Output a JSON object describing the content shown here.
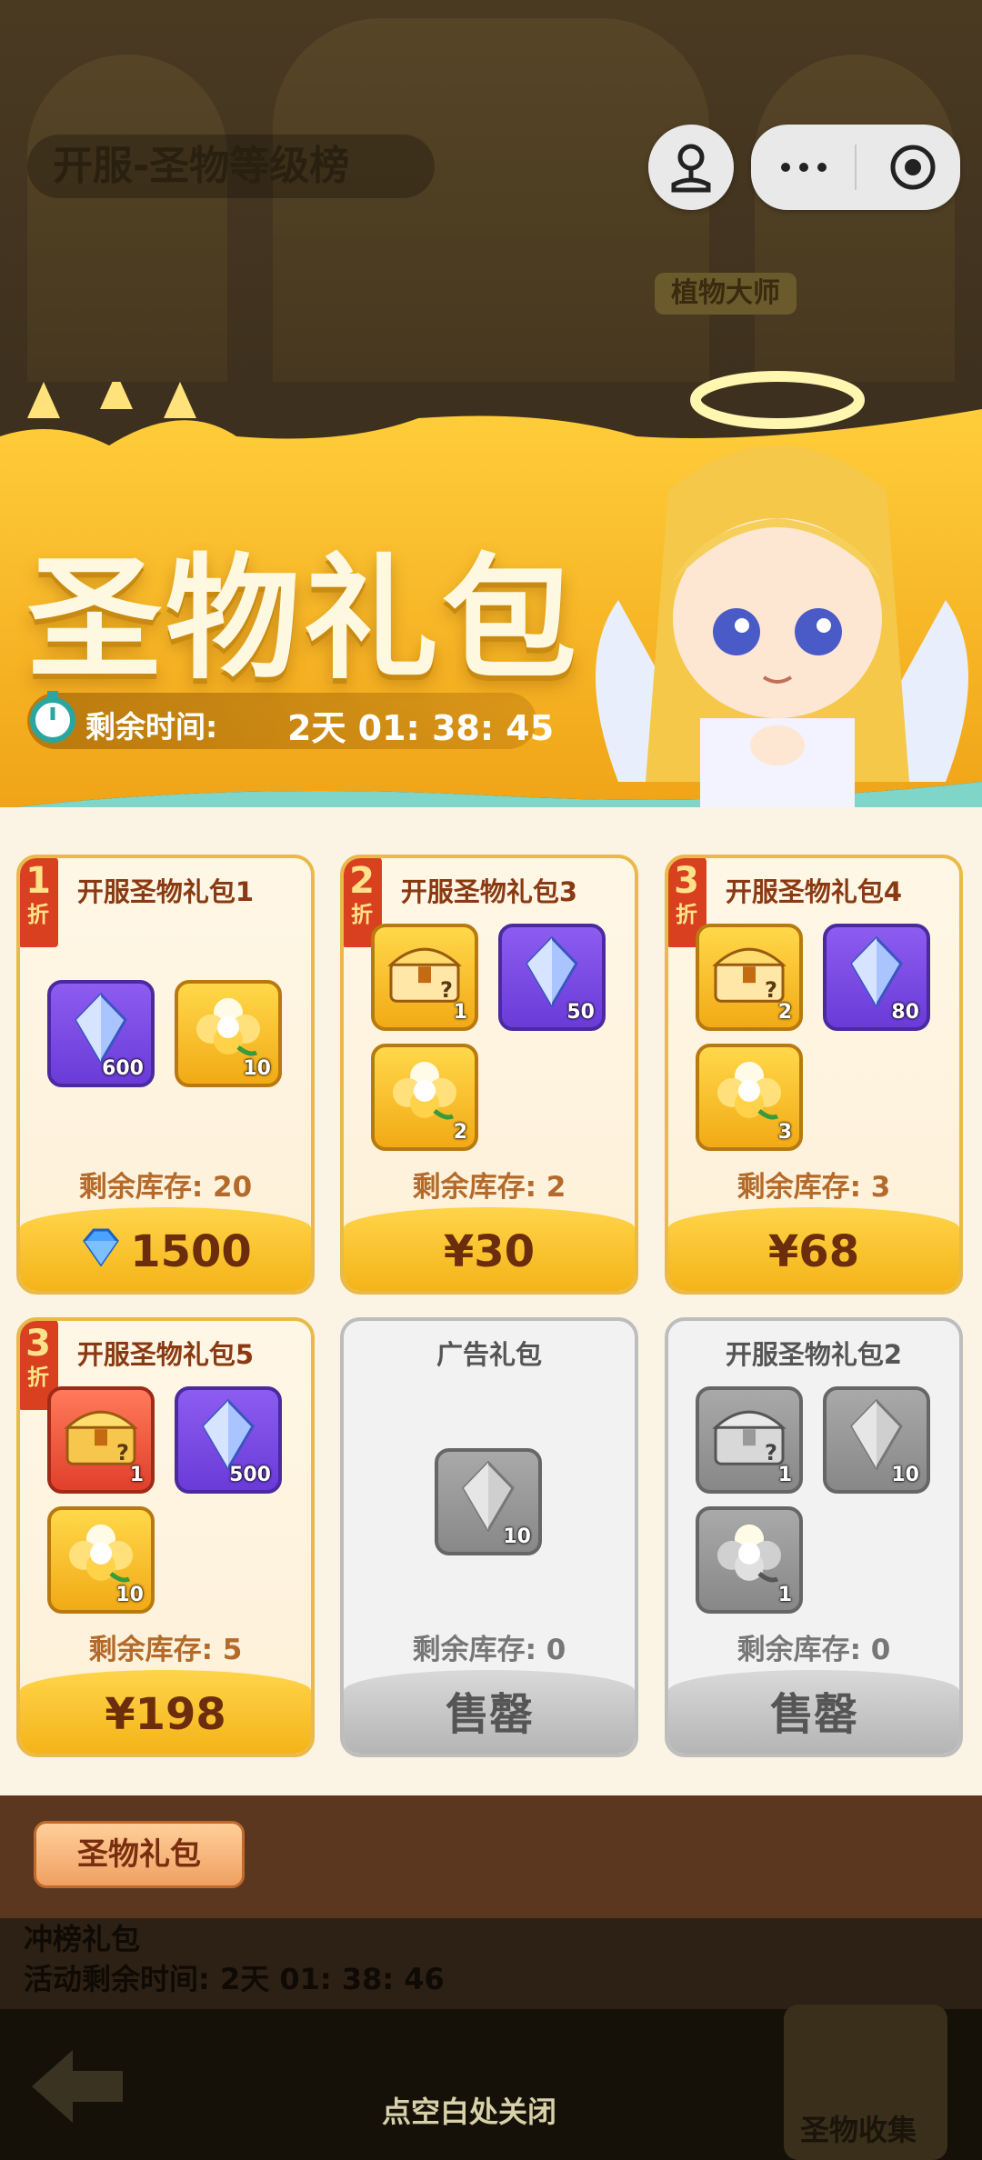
{
  "background": {
    "title": "开服-圣物等级榜",
    "badge": "植物大师",
    "rank_title": "冲榜礼包",
    "rank_timer": "活动剩余时间: 2天 01: 38: 46",
    "collect_label": "圣物收集",
    "close_hint": "点空白处关闭"
  },
  "banner": {
    "title": "圣物礼包",
    "timer_label": "剩余时间:",
    "timer_value": "2天 01: 38: 45"
  },
  "cards": [
    {
      "title": "开服圣物礼包1",
      "discount": "1",
      "discount_unit": "折",
      "style": "gold",
      "stock": "剩余库存: 20",
      "price": "1500",
      "price_icon": "diamond-icon",
      "items": [
        {
          "icon": "crystal-icon",
          "color": "purple",
          "qty": "600"
        },
        {
          "icon": "flower-icon",
          "color": "gold",
          "qty": "10"
        }
      ]
    },
    {
      "title": "开服圣物礼包3",
      "discount": "2",
      "discount_unit": "折",
      "style": "gold",
      "stock": "剩余库存: 2",
      "price": "¥30",
      "items": [
        {
          "icon": "chest-icon",
          "color": "gold",
          "qty": "1"
        },
        {
          "icon": "crystal-icon",
          "color": "purple",
          "qty": "50"
        },
        {
          "icon": "flower-icon",
          "color": "gold",
          "qty": "2"
        }
      ]
    },
    {
      "title": "开服圣物礼包4",
      "discount": "3",
      "discount_unit": "折",
      "style": "gold",
      "stock": "剩余库存: 3",
      "price": "¥68",
      "items": [
        {
          "icon": "chest-icon",
          "color": "gold",
          "qty": "2"
        },
        {
          "icon": "crystal-icon",
          "color": "purple",
          "qty": "80"
        },
        {
          "icon": "flower-icon",
          "color": "gold",
          "qty": "3"
        }
      ]
    },
    {
      "title": "开服圣物礼包5",
      "discount": "3",
      "discount_unit": "折",
      "style": "gold",
      "stock": "剩余库存: 5",
      "price": "¥198",
      "items": [
        {
          "icon": "chest-icon",
          "color": "red",
          "qty": "1"
        },
        {
          "icon": "crystal-icon",
          "color": "purple",
          "qty": "500"
        },
        {
          "icon": "flower-icon",
          "color": "gold",
          "qty": "10"
        }
      ]
    },
    {
      "title": "广告礼包",
      "style": "grey",
      "stock": "剩余库存: 0",
      "price": "售罄",
      "items": [
        {
          "icon": "crystal-icon",
          "color": "greyitem",
          "qty": "10"
        }
      ]
    },
    {
      "title": "开服圣物礼包2",
      "style": "grey",
      "stock": "剩余库存: 0",
      "price": "售罄",
      "items": [
        {
          "icon": "chest-icon",
          "color": "greyitem",
          "qty": "1"
        },
        {
          "icon": "crystal-icon",
          "color": "greyitem",
          "qty": "10"
        },
        {
          "icon": "flower-icon",
          "color": "greyitem",
          "qty": "1"
        }
      ]
    }
  ],
  "tabbar": {
    "tab_label": "圣物礼包"
  },
  "colors": {
    "gold": "#f4b419",
    "purple": "#6a3bd8",
    "red": "#e0402c",
    "brown": "#5b3720"
  }
}
